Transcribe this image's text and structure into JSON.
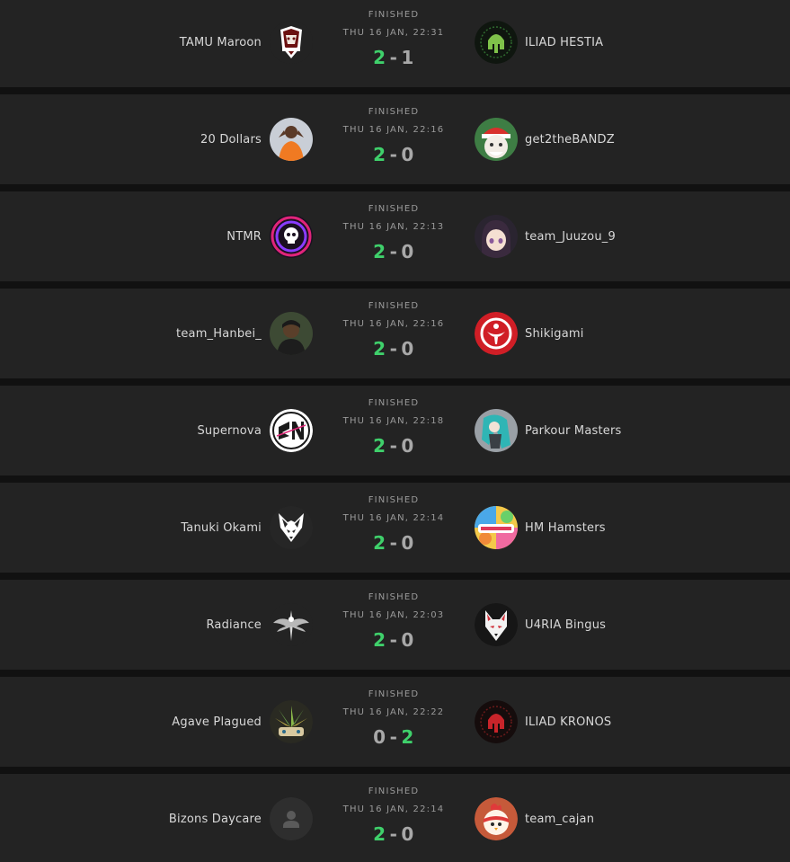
{
  "colors": {
    "row_background": "#232323",
    "page_background": "#111111",
    "winner_score": "#3fd06b",
    "loser_score": "#a8a8a8",
    "muted_text": "#9a9a9a",
    "team_text": "#d8d8d8"
  },
  "matches": [
    {
      "status": "FINISHED",
      "datetime": "THU 16 JAN, 22:31",
      "left": {
        "name": "TAMU Maroon",
        "score": "2",
        "icon": "texas-aggie-logo"
      },
      "right": {
        "name": "ILIAD HESTIA",
        "score": "1",
        "icon": "green-spartan-helmet"
      },
      "winner": "left"
    },
    {
      "status": "FINISHED",
      "datetime": "THU 16 JAN, 22:16",
      "left": {
        "name": "20 Dollars",
        "score": "2",
        "icon": "player-photo"
      },
      "right": {
        "name": "get2theBANDZ",
        "score": "0",
        "icon": "santa-cat"
      },
      "winner": "left"
    },
    {
      "status": "FINISHED",
      "datetime": "THU 16 JAN, 22:13",
      "left": {
        "name": "NTMR",
        "score": "2",
        "icon": "neon-skull"
      },
      "right": {
        "name": "team_Juuzou_9",
        "score": "0",
        "icon": "anime-girl"
      },
      "winner": "left"
    },
    {
      "status": "FINISHED",
      "datetime": "THU 16 JAN, 22:16",
      "left": {
        "name": "team_Hanbei_",
        "score": "2",
        "icon": "player-photo"
      },
      "right": {
        "name": "Shikigami",
        "score": "0",
        "icon": "red-emblem"
      },
      "winner": "left"
    },
    {
      "status": "FINISHED",
      "datetime": "THU 16 JAN, 22:18",
      "left": {
        "name": "Supernova",
        "score": "2",
        "icon": "sn-logo"
      },
      "right": {
        "name": "Parkour Masters",
        "score": "0",
        "icon": "anime-figure"
      },
      "winner": "left"
    },
    {
      "status": "FINISHED",
      "datetime": "THU 16 JAN, 22:14",
      "left": {
        "name": "Tanuki Okami",
        "score": "2",
        "icon": "wolf-head"
      },
      "right": {
        "name": "HM Hamsters",
        "score": "0",
        "icon": "hamsters-logo"
      },
      "winner": "left"
    },
    {
      "status": "FINISHED",
      "datetime": "THU 16 JAN, 22:03",
      "left": {
        "name": "Radiance",
        "score": "2",
        "icon": "winged-emblem"
      },
      "right": {
        "name": "U4RIA Bingus",
        "score": "0",
        "icon": "kitsune-mask"
      },
      "winner": "left"
    },
    {
      "status": "FINISHED",
      "datetime": "THU 16 JAN, 22:22",
      "left": {
        "name": "Agave Plagued",
        "score": "0",
        "icon": "agave-plant"
      },
      "right": {
        "name": "ILIAD KRONOS",
        "score": "2",
        "icon": "red-spartan-helmet"
      },
      "winner": "right"
    },
    {
      "status": "FINISHED",
      "datetime": "THU 16 JAN, 22:14",
      "left": {
        "name": "Bizons Daycare",
        "score": "2",
        "icon": "default-avatar"
      },
      "right": {
        "name": "team_cajan",
        "score": "0",
        "icon": "chicken-character"
      },
      "winner": "left"
    }
  ]
}
